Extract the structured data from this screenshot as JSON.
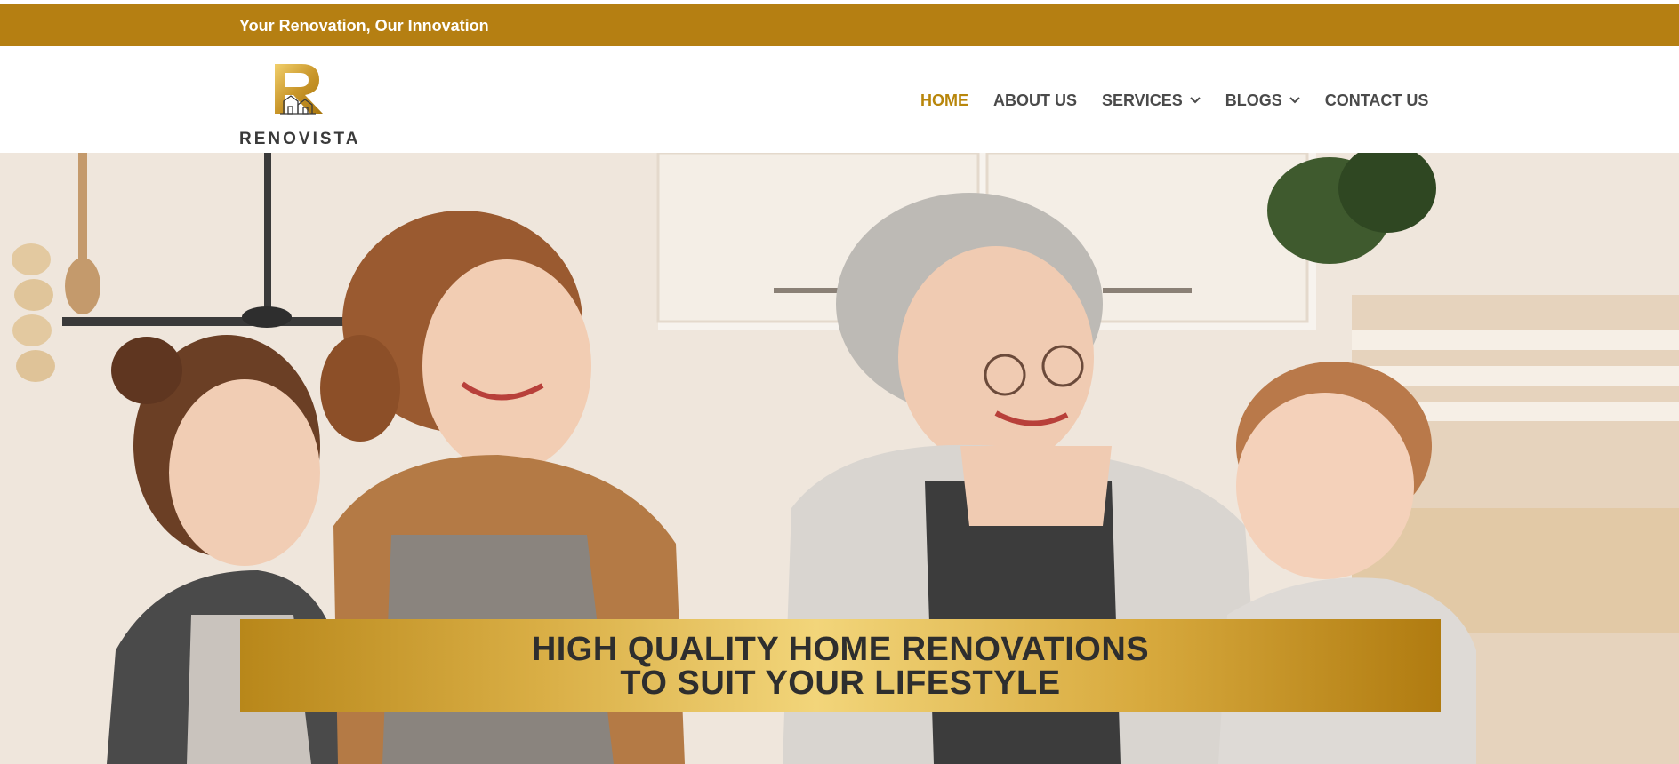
{
  "top_bar": {
    "tagline": "Your Renovation, Our Innovation",
    "contact_partial": ""
  },
  "logo": {
    "brand": "RENOVISTA",
    "mark_letter": "R"
  },
  "nav": {
    "items": [
      {
        "label": "HOME",
        "active": true,
        "has_dropdown": false
      },
      {
        "label": "ABOUT US",
        "active": false,
        "has_dropdown": false
      },
      {
        "label": "SERVICES",
        "active": false,
        "has_dropdown": true
      },
      {
        "label": "BLOGS",
        "active": false,
        "has_dropdown": true
      },
      {
        "label": "CONTACT US",
        "active": false,
        "has_dropdown": false
      }
    ],
    "chevron": "⌄"
  },
  "hero": {
    "headline_line1": "HIGH QUALITY HOME RENOVATIONS",
    "headline_line2": "TO SUIT YOUR LIFESTYLE"
  },
  "colors": {
    "brand_gold": "#b57f12",
    "nav_active": "#b8860b",
    "nav_text": "#4a4a4a"
  }
}
